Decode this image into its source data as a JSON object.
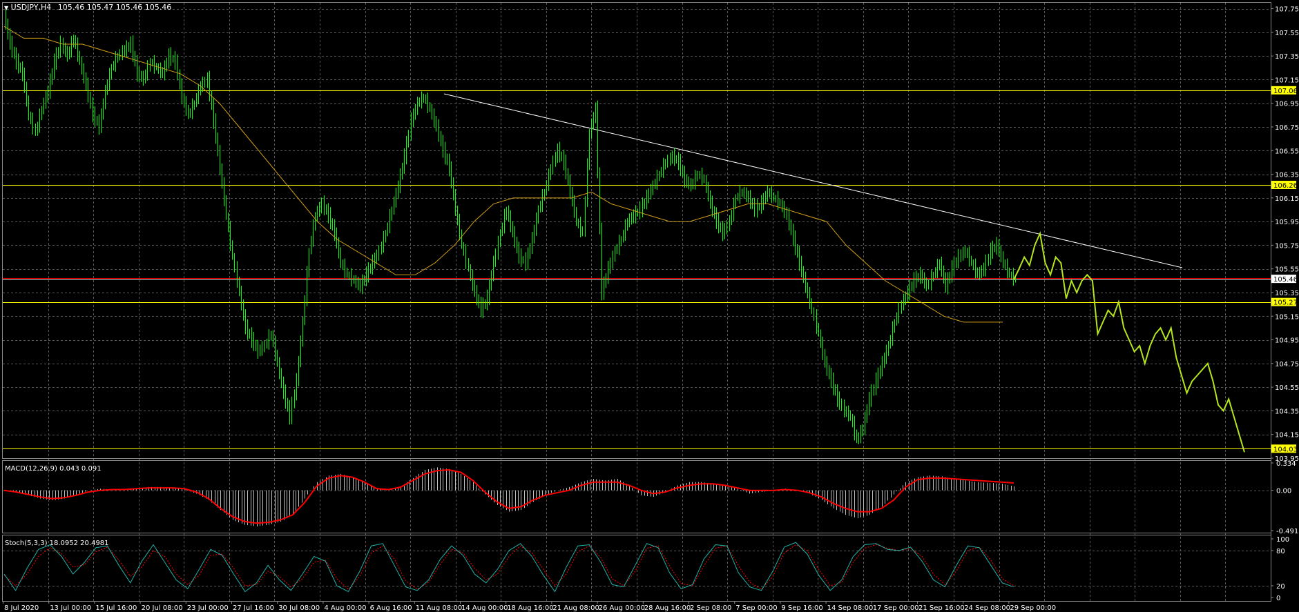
{
  "header": {
    "symbol": "USDJPY,H4",
    "ohlc": "105.46 105.47 105.46 105.46",
    "dropdown_icon": "triangle-down-icon"
  },
  "colors": {
    "background": "#000000",
    "grid": "#5a5a5a",
    "candle": "#00ff00",
    "ma": "#d4a017",
    "level_line": "#ffff00",
    "price_line": "#ff0000",
    "trendline": "#ffffff",
    "projection": "#b5e61d",
    "macd_hist": "#c0c0c0",
    "macd_signal": "#ff0000",
    "stoch_main": "#20b2aa",
    "stoch_signal": "#ff0000"
  },
  "chart_data": [
    {
      "type": "line",
      "title": "USDJPY,H4",
      "ylim": [
        103.95,
        107.8
      ],
      "y_ticks": [
        107.75,
        107.55,
        107.35,
        107.15,
        106.95,
        106.75,
        106.55,
        106.35,
        106.15,
        105.95,
        105.75,
        105.55,
        105.35,
        105.15,
        104.95,
        104.75,
        104.55,
        104.35,
        104.15,
        103.95
      ],
      "x_labels": [
        "8 Jul 2020",
        "13 Jul 00:00",
        "15 Jul 16:00",
        "20 Jul 08:00",
        "23 Jul 00:00",
        "27 Jul 16:00",
        "30 Jul 08:00",
        "4 Aug 00:00",
        "6 Aug 16:00",
        "11 Aug 08:00",
        "14 Aug 00:00",
        "18 Aug 16:00",
        "21 Aug 08:00",
        "26 Aug 00:00",
        "28 Aug 16:00",
        "2 Sep 08:00",
        "7 Sep 00:00",
        "9 Sep 16:00",
        "14 Sep 08:00",
        "17 Sep 00:00",
        "21 Sep 16:00",
        "24 Sep 08:00",
        "29 Sep 00:00"
      ],
      "horizontal_levels": [
        {
          "label": "107.06",
          "value": 107.06
        },
        {
          "label": "106.26",
          "value": 106.26
        },
        {
          "label": "105.27",
          "value": 105.27
        },
        {
          "label": "104.03",
          "value": 104.03
        }
      ],
      "current_price": {
        "label": "105.46",
        "value": 105.46
      },
      "series": [
        {
          "values": [
            107.7,
            107.45,
            107.3,
            107.2,
            106.85,
            106.7,
            106.9,
            107.05,
            107.3,
            107.45,
            107.35,
            107.5,
            107.3,
            107.1,
            106.85,
            106.75,
            107.05,
            107.25,
            107.35,
            107.4,
            107.45,
            107.2,
            107.15,
            107.3,
            107.25,
            107.2,
            107.35,
            107.3,
            107.0,
            106.85,
            106.95,
            107.1,
            107.15,
            106.8,
            106.4,
            106.0,
            105.65,
            105.35,
            105.05,
            104.95,
            104.85,
            104.9,
            105.0,
            104.75,
            104.5,
            104.3,
            104.6,
            105.1,
            105.7,
            106.0,
            106.1,
            106.0,
            105.85,
            105.6,
            105.5,
            105.45,
            105.4,
            105.5,
            105.6,
            105.7,
            105.85,
            106.05,
            106.25,
            106.5,
            106.8,
            106.95,
            107.0,
            106.9,
            106.75,
            106.55,
            106.4,
            106.05,
            105.75,
            105.55,
            105.35,
            105.2,
            105.3,
            105.6,
            105.85,
            106.05,
            105.85,
            105.65,
            105.6,
            105.8,
            106.05,
            106.2,
            106.4,
            106.55,
            106.45,
            106.2,
            105.95,
            105.85,
            106.7,
            106.9,
            105.35,
            105.55,
            105.7,
            105.8,
            105.95,
            106.0,
            106.05,
            106.15,
            106.25,
            106.35,
            106.45,
            106.5,
            106.45,
            106.3,
            106.25,
            106.35,
            106.3,
            106.1,
            105.95,
            105.85,
            105.95,
            106.15,
            106.2,
            106.15,
            106.05,
            106.1,
            106.2,
            106.15,
            106.1,
            106.0,
            105.8,
            105.6,
            105.4,
            105.2,
            105.0,
            104.75,
            104.6,
            104.45,
            104.35,
            104.3,
            104.1,
            104.2,
            104.45,
            104.6,
            104.75,
            104.9,
            105.1,
            105.25,
            105.35,
            105.45,
            105.5,
            105.4,
            105.5,
            105.6,
            105.4,
            105.55,
            105.65,
            105.7,
            105.6,
            105.5,
            105.55,
            105.7,
            105.75,
            105.6,
            105.5,
            105.46
          ]
        },
        {
          "values": [
            107.6,
            107.5,
            107.5,
            107.45,
            107.45,
            107.4,
            107.35,
            107.3,
            107.25,
            107.2,
            107.1,
            106.95,
            106.75,
            106.55,
            106.35,
            106.15,
            105.95,
            105.8,
            105.7,
            105.6,
            105.5,
            105.5,
            105.6,
            105.75,
            105.95,
            106.1,
            106.15,
            106.15,
            106.15,
            106.15,
            106.2,
            106.1,
            106.05,
            106.0,
            105.95,
            105.95,
            106.0,
            106.05,
            106.1,
            106.1,
            106.05,
            106.0,
            105.95,
            105.75,
            105.6,
            105.45,
            105.35,
            105.25,
            105.15,
            105.1,
            105.1,
            105.1
          ]
        },
        {
          "values": [
            105.46,
            105.55,
            105.65,
            105.58,
            105.75,
            105.85,
            105.6,
            105.5,
            105.65,
            105.6,
            105.3,
            105.45,
            105.35,
            105.45,
            105.5,
            105.45,
            105.0,
            105.1,
            105.2,
            105.15,
            105.27,
            105.05,
            104.95,
            104.85,
            104.9,
            104.75,
            104.9,
            105.0,
            105.05,
            104.95,
            105.05,
            104.8,
            104.65,
            104.5,
            104.6,
            104.65,
            104.7,
            104.75,
            104.6,
            104.4,
            104.35,
            104.45,
            104.3,
            104.15,
            104.0
          ]
        },
        {
          "values": [
            107.03,
            105.56
          ]
        }
      ]
    },
    {
      "type": "bar",
      "title": "MACD(12,26,9) 0.043 0.091",
      "ylim": [
        -0.491,
        0.334
      ],
      "y_ticks": [
        0.334,
        0.0,
        -0.491
      ],
      "series": [
        {
          "values": [
            0.0,
            -0.02,
            -0.06,
            -0.1,
            -0.12,
            -0.1,
            -0.06,
            0.0,
            0.02,
            0.01,
            0.0,
            0.02,
            0.04,
            0.04,
            0.03,
            0.01,
            -0.04,
            -0.12,
            -0.24,
            -0.36,
            -0.42,
            -0.44,
            -0.42,
            -0.38,
            -0.3,
            -0.1,
            0.1,
            0.18,
            0.2,
            0.16,
            0.1,
            0.02,
            0.0,
            0.05,
            0.15,
            0.25,
            0.28,
            0.26,
            0.2,
            0.1,
            -0.05,
            -0.18,
            -0.26,
            -0.24,
            -0.14,
            -0.06,
            0.0,
            0.04,
            0.1,
            0.14,
            0.12,
            0.14,
            0.06,
            -0.06,
            -0.08,
            -0.02,
            0.06,
            0.1,
            0.1,
            0.08,
            0.06,
            0.02,
            -0.04,
            -0.02,
            0.0,
            0.02,
            0.0,
            -0.04,
            -0.12,
            -0.22,
            -0.3,
            -0.34,
            -0.3,
            -0.2,
            -0.05,
            0.1,
            0.16,
            0.18,
            0.17,
            0.14,
            0.12,
            0.1,
            0.09,
            0.08,
            0.05
          ]
        },
        {
          "values": [
            0.0,
            -0.02,
            -0.05,
            -0.08,
            -0.1,
            -0.09,
            -0.06,
            -0.02,
            0.0,
            0.01,
            0.01,
            0.02,
            0.03,
            0.03,
            0.03,
            0.02,
            -0.02,
            -0.1,
            -0.22,
            -0.32,
            -0.38,
            -0.4,
            -0.39,
            -0.36,
            -0.3,
            -0.15,
            0.05,
            0.15,
            0.18,
            0.16,
            0.1,
            0.02,
            0.01,
            0.04,
            0.12,
            0.2,
            0.24,
            0.25,
            0.22,
            0.12,
            -0.02,
            -0.14,
            -0.22,
            -0.2,
            -0.12,
            -0.06,
            -0.03,
            0.0,
            0.06,
            0.1,
            0.1,
            0.1,
            0.06,
            0.0,
            -0.04,
            -0.02,
            0.03,
            0.06,
            0.08,
            0.08,
            0.06,
            0.03,
            0.0,
            0.0,
            0.0,
            0.01,
            0.0,
            -0.03,
            -0.08,
            -0.16,
            -0.22,
            -0.26,
            -0.26,
            -0.22,
            -0.12,
            0.04,
            0.13,
            0.15,
            0.15,
            0.14,
            0.13,
            0.12,
            0.11,
            0.1,
            0.09
          ]
        }
      ]
    },
    {
      "type": "line",
      "title": "Stoch(5,3,3) 18.0952 20.4981",
      "ylim": [
        0,
        100
      ],
      "y_ticks": [
        100,
        80,
        20,
        0
      ],
      "series": [
        {
          "values": [
            40,
            12,
            50,
            82,
            90,
            70,
            40,
            60,
            85,
            88,
            55,
            25,
            62,
            90,
            60,
            30,
            15,
            48,
            82,
            72,
            40,
            10,
            25,
            55,
            30,
            12,
            40,
            70,
            62,
            20,
            10,
            45,
            88,
            92,
            55,
            18,
            12,
            30,
            65,
            88,
            72,
            40,
            25,
            48,
            80,
            92,
            70,
            38,
            10,
            52,
            88,
            90,
            60,
            22,
            18,
            55,
            92,
            85,
            42,
            15,
            22,
            66,
            90,
            88,
            42,
            18,
            12,
            45,
            86,
            94,
            74,
            38,
            12,
            30,
            70,
            90,
            92,
            82,
            80,
            86,
            62,
            30,
            18,
            55,
            88,
            85,
            55,
            25,
            18
          ]
        },
        {
          "values": [
            38,
            20,
            40,
            70,
            85,
            75,
            52,
            56,
            78,
            86,
            64,
            36,
            52,
            80,
            70,
            40,
            22,
            38,
            72,
            74,
            50,
            20,
            22,
            45,
            36,
            18,
            32,
            60,
            64,
            32,
            14,
            36,
            76,
            88,
            66,
            28,
            14,
            26,
            56,
            82,
            76,
            50,
            30,
            40,
            70,
            88,
            76,
            48,
            20,
            40,
            78,
            88,
            68,
            32,
            20,
            45,
            84,
            88,
            54,
            24,
            20,
            54,
            84,
            88,
            54,
            26,
            14,
            36,
            76,
            90,
            80,
            48,
            20,
            26,
            60,
            84,
            90,
            84,
            80,
            84,
            70,
            40,
            22,
            45,
            80,
            86,
            64,
            32,
            20
          ]
        }
      ]
    }
  ]
}
